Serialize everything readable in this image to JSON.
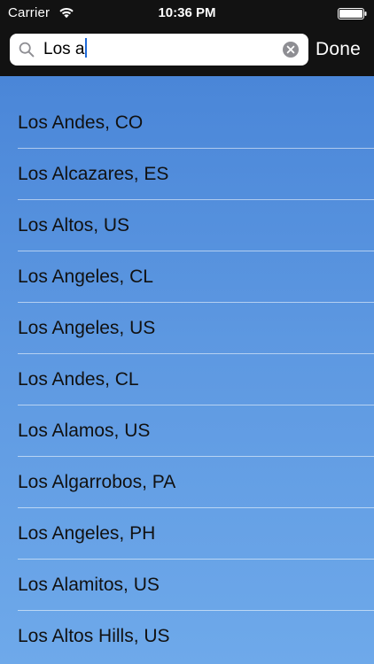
{
  "status_bar": {
    "carrier": "Carrier",
    "time": "10:36 PM"
  },
  "search": {
    "query": "Los a",
    "icon": "search-icon",
    "clear_icon": "clear-icon"
  },
  "done_label": "Done",
  "results": [
    "Los Andes, CO",
    "Los Alcazares, ES",
    "Los Altos, US",
    "Los Angeles, CL",
    "Los Angeles, US",
    "Los Andes, CL",
    "Los Alamos, US",
    "Los Algarrobos, PA",
    "Los Angeles, PH",
    "Los Alamitos, US",
    "Los Altos Hills, US"
  ],
  "colors": {
    "top_background": "#121212",
    "list_gradient_top": "#4a86d8",
    "list_gradient_bottom": "#6ea9ea",
    "caret": "#1f6ad9"
  }
}
